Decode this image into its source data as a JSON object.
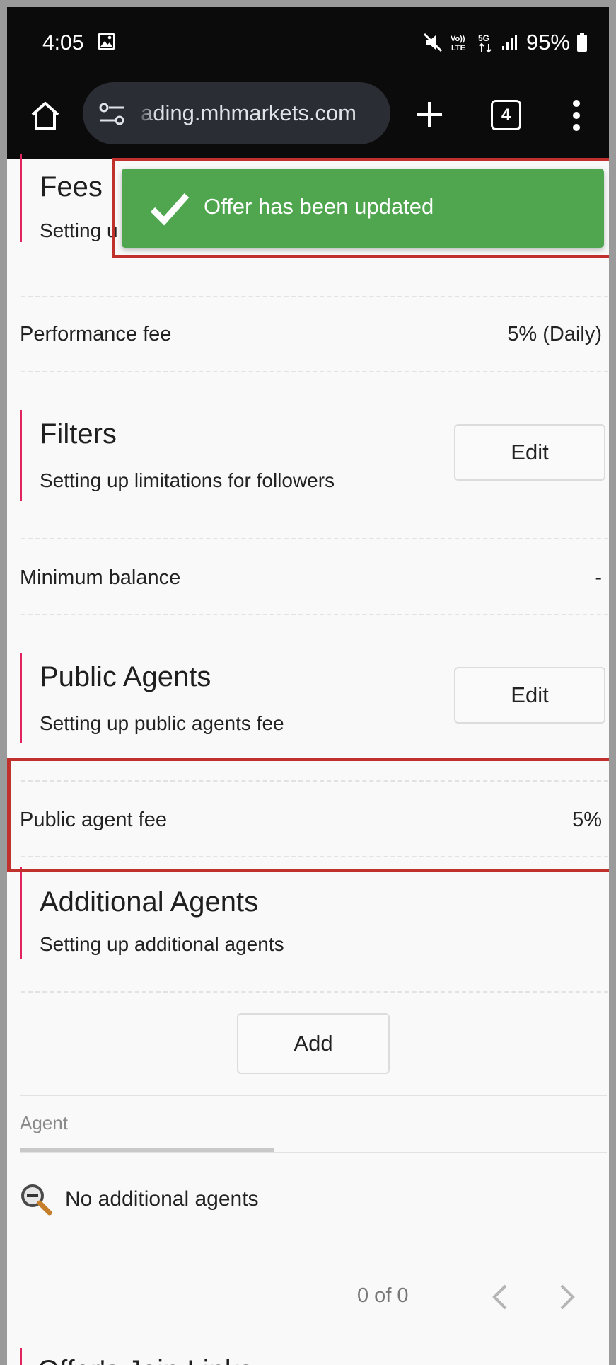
{
  "status_bar": {
    "time": "4:05",
    "battery": "95%",
    "network": "5G",
    "volte": "Vo)) LTE"
  },
  "browser": {
    "url": "ading.mhmarkets.com",
    "tab_count": "4"
  },
  "toast": {
    "message": "Offer has been updated",
    "color": "#4fa64f"
  },
  "sections": {
    "fees": {
      "title": "Fees",
      "subtitle": "Setting u",
      "rows": [
        {
          "label": "Performance fee",
          "value": "5% (Daily)"
        }
      ]
    },
    "filters": {
      "title": "Filters",
      "subtitle": "Setting up limitations for followers",
      "edit_label": "Edit",
      "rows": [
        {
          "label": "Minimum balance",
          "value": "-"
        }
      ]
    },
    "public_agents": {
      "title": "Public Agents",
      "subtitle": "Setting up public agents fee",
      "edit_label": "Edit",
      "rows": [
        {
          "label": "Public agent fee",
          "value": "5%"
        }
      ]
    },
    "additional_agents": {
      "title": "Additional Agents",
      "subtitle": "Setting up additional agents",
      "add_label": "Add",
      "table": {
        "column": "Agent",
        "empty_text": "No additional agents"
      },
      "pagination": "0 of 0"
    },
    "next_section": {
      "title": "Offer's Join Links"
    }
  },
  "colors": {
    "accent_bar": "#e0245e",
    "highlight_box": "#c0302c"
  }
}
